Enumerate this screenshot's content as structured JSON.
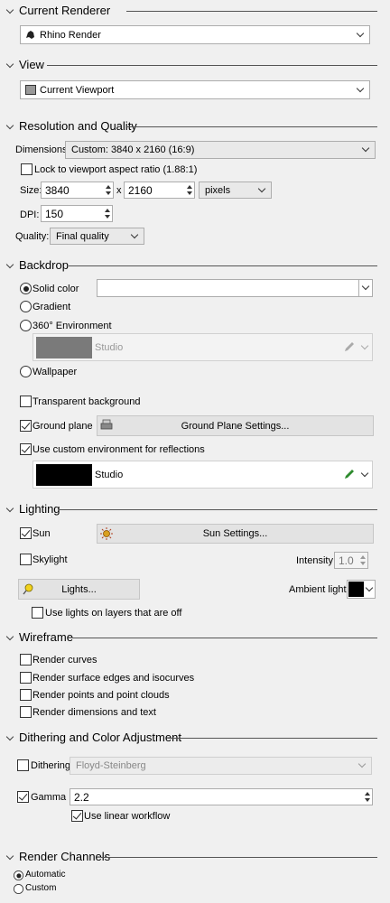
{
  "sections": {
    "current_renderer": "Current Renderer",
    "view": "View",
    "resolution": "Resolution and Quality",
    "backdrop": "Backdrop",
    "lighting": "Lighting",
    "wireframe": "Wireframe",
    "dithering": "Dithering and Color Adjustment",
    "channels": "Render Channels"
  },
  "renderer": {
    "value": "Rhino Render"
  },
  "view": {
    "value": "Current Viewport"
  },
  "resolution": {
    "dimensions_label": "Dimensions:",
    "dimensions_value": "Custom: 3840 x 2160 (16:9)",
    "lock_label": "Lock to viewport aspect ratio (1.88:1)",
    "lock_checked": false,
    "size_label": "Size:",
    "width": "3840",
    "x_sep": "x",
    "height": "2160",
    "units": "pixels",
    "dpi_label": "DPI:",
    "dpi": "150",
    "quality_label": "Quality:",
    "quality": "Final quality"
  },
  "backdrop": {
    "solid_color": "Solid color",
    "gradient": "Gradient",
    "environment": "360° Environment",
    "env_name": "Studio",
    "wallpaper": "Wallpaper",
    "transparent": "Transparent background",
    "ground_plane": "Ground plane",
    "ground_plane_settings": "Ground Plane Settings...",
    "custom_env": "Use custom environment for reflections",
    "custom_env_name": "Studio",
    "selected": "Solid color"
  },
  "lighting": {
    "sun": "Sun",
    "sun_settings": "Sun Settings...",
    "skylight": "Skylight",
    "intensity_label": "Intensity:",
    "intensity": "1.0",
    "lights": "Lights...",
    "ambient_label": "Ambient light:",
    "lights_off_layers": "Use lights on layers that are off"
  },
  "wireframe": {
    "curves": "Render curves",
    "edges": "Render surface edges and isocurves",
    "points": "Render points and point clouds",
    "dimensions": "Render dimensions and text"
  },
  "dithering": {
    "dithering_label": "Dithering:",
    "dithering_value": "Floyd-Steinberg",
    "gamma_label": "Gamma",
    "gamma": "2.2",
    "linear": "Use linear workflow"
  },
  "channels": {
    "automatic": "Automatic",
    "custom": "Custom",
    "selected": "Automatic"
  },
  "colors": {
    "panel_bg": "#f0f0f0",
    "ambient": "#000000",
    "env_swatch": "#7a7a7a",
    "custom_env_swatch": "#000000",
    "pencil_active": "#2e8b2e"
  }
}
